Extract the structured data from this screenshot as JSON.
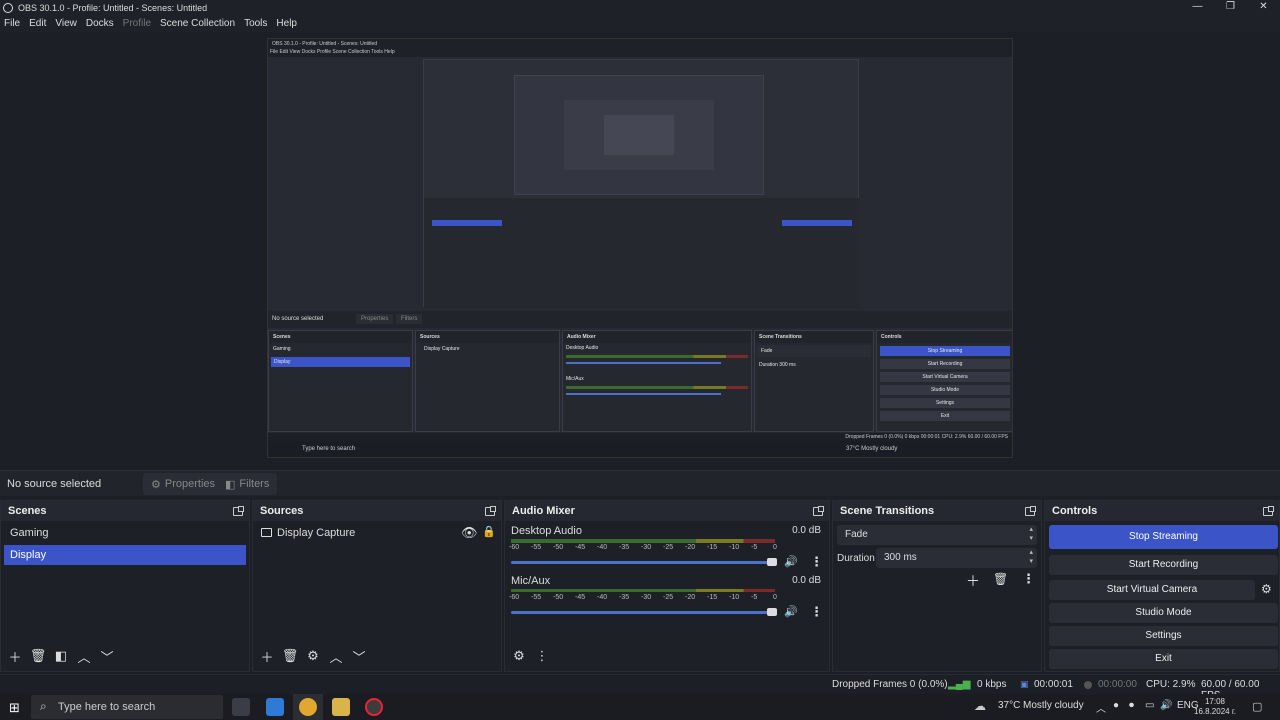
{
  "window": {
    "title": "OBS 30.1.0 - Profile: Untitled - Scenes: Untitled",
    "minimize": "—",
    "restore": "❐",
    "close": "✕"
  },
  "menu": {
    "items": [
      "File",
      "Edit",
      "View",
      "Docks",
      "Profile",
      "Scene Collection",
      "Tools",
      "Help"
    ]
  },
  "preview": {
    "nested_title": "OBS 30.1.0 - Profile: Untitled - Scenes: Untitled",
    "nested_menu": "File   Edit   View   Docks   Profile   Scene Collection   Tools   Help",
    "nested_no_source": "No source selected",
    "nested_properties": "Properties",
    "nested_filters": "Filters",
    "nested_scenes": "Scenes",
    "nested_gaming": "Gaming",
    "nested_display": "Display",
    "nested_sources": "Sources",
    "nested_display_capture": "Display Capture",
    "nested_mixer": "Audio Mixer",
    "nested_desktop_audio": "Desktop Audio",
    "nested_mic": "Mic/Aux",
    "nested_transitions": "Scene Transitions",
    "nested_fade": "Fade",
    "nested_duration": "Duration",
    "nested_duration_val": "300 ms",
    "nested_controls": "Controls",
    "nested_stop": "Stop Streaming",
    "nested_record": "Start Recording",
    "nested_vcam": "Start Virtual Camera",
    "nested_studio": "Studio Mode",
    "nested_settings": "Settings",
    "nested_exit": "Exit",
    "nested_search": "Type here to search",
    "nested_status": "Dropped Frames 0 (0.0%)   0 kbps   00:00:01   CPU: 2.9%   60.00 / 60.00 FPS",
    "nested_weather": "37°C  Mostly cloudy"
  },
  "context": {
    "no_source": "No source selected",
    "properties": "Properties",
    "filters": "Filters"
  },
  "scenes": {
    "title": "Scenes",
    "items": [
      "Gaming",
      "Display"
    ],
    "selected": "Display"
  },
  "sources": {
    "title": "Sources",
    "items": [
      {
        "name": "Display Capture"
      }
    ]
  },
  "mixer": {
    "title": "Audio Mixer",
    "scale": [
      "-60",
      "-55",
      "-50",
      "-45",
      "-40",
      "-35",
      "-30",
      "-25",
      "-20",
      "-15",
      "-10",
      "-5",
      "0"
    ],
    "channels": [
      {
        "name": "Desktop Audio",
        "db": "0.0 dB",
        "volume": 1.0
      },
      {
        "name": "Mic/Aux",
        "db": "0.0 dB",
        "volume": 1.0
      }
    ]
  },
  "transitions": {
    "title": "Scene Transitions",
    "selected": "Fade",
    "duration_label": "Duration",
    "duration_value": "300 ms"
  },
  "controls": {
    "title": "Controls",
    "stop_streaming": "Stop Streaming",
    "start_recording": "Start Recording",
    "start_virtual_camera": "Start Virtual Camera",
    "studio_mode": "Studio Mode",
    "settings": "Settings",
    "exit": "Exit"
  },
  "status": {
    "dropped_frames": "Dropped Frames 0 (0.0%)",
    "kbps": "0 kbps",
    "stream_time": "00:00:01",
    "record_time": "00:00:00",
    "cpu": "CPU: 2.9%",
    "fps": "60.00 / 60.00 FPS"
  },
  "taskbar": {
    "search_placeholder": "Type here to search",
    "temperature": "37°C",
    "weather": "Mostly cloudy",
    "language": "ENG",
    "time": "17:08",
    "date": "16.8.2024 г."
  },
  "colors": {
    "accent": "#3b55c9",
    "background": "#1d1f26",
    "dock": "#1e2028"
  }
}
